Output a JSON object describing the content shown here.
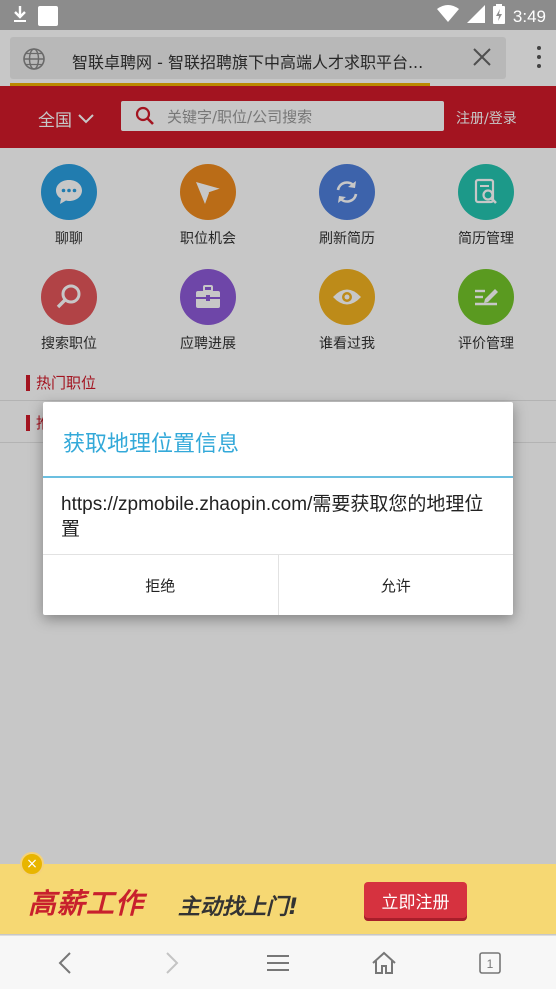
{
  "status_bar": {
    "time": "3:49"
  },
  "browser": {
    "tab_title": "智联卓聘网 - 智联招聘旗下中高端人才求职平台...",
    "tab_count": "1"
  },
  "header": {
    "region": "全国",
    "search_placeholder": "关键字/职位/公司搜索",
    "login": "注册/登录"
  },
  "shortcuts": [
    {
      "label": "聊聊",
      "icon": "chat-icon",
      "color": "#2b9fe0"
    },
    {
      "label": "职位机会",
      "icon": "paper-plane-icon",
      "color": "#ef8b1e"
    },
    {
      "label": "刷新简历",
      "icon": "refresh-icon",
      "color": "#4f7fdc"
    },
    {
      "label": "简历管理",
      "icon": "resume-search-icon",
      "color": "#24c4b0"
    },
    {
      "label": "搜索职位",
      "icon": "search-icon",
      "color": "#e3565a"
    },
    {
      "label": "应聘进展",
      "icon": "briefcase-icon",
      "color": "#8e5ad8"
    },
    {
      "label": "谁看过我",
      "icon": "eye-icon",
      "color": "#f2b320"
    },
    {
      "label": "评价管理",
      "icon": "review-icon",
      "color": "#74c62a"
    }
  ],
  "sections": {
    "hot_jobs": "热门职位",
    "second_prefix": "推"
  },
  "dialog": {
    "title": "获取地理位置信息",
    "message": "https://zpmobile.zhaopin.com/需要获取您的地理位置",
    "deny": "拒绝",
    "allow": "允许"
  },
  "banner": {
    "slogan_main": "高薪工作",
    "slogan_sub": "主动找上门!",
    "cta": "立即注册",
    "close": "×"
  }
}
